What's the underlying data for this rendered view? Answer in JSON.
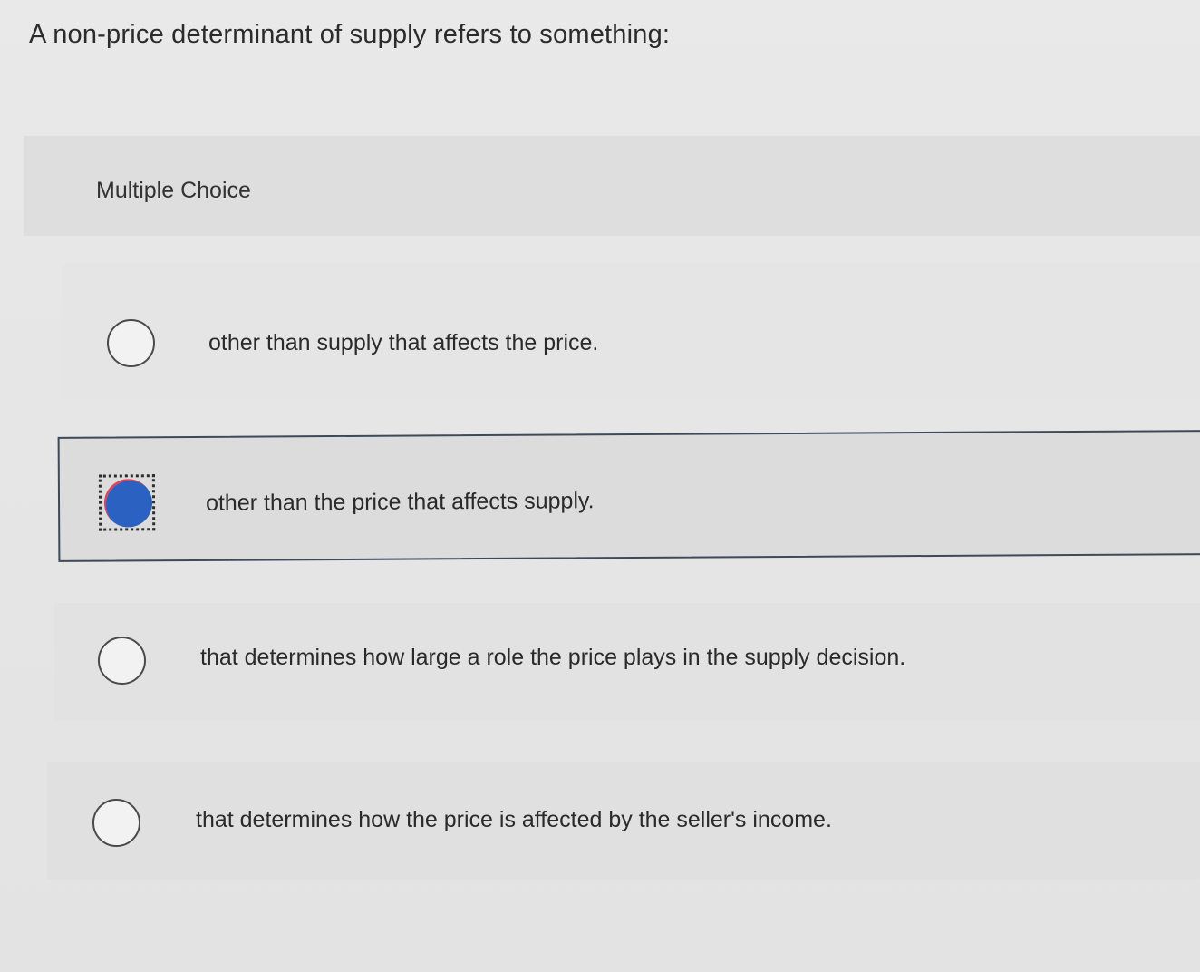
{
  "question": {
    "text": "A non-price determinant of supply refers to something:"
  },
  "question_type": {
    "label": "Multiple Choice"
  },
  "options": [
    {
      "text": "other than supply that affects the price.",
      "selected": false
    },
    {
      "text": "other than the price that affects supply.",
      "selected": true
    },
    {
      "text": "that determines how large a role the price plays in the supply decision.",
      "selected": false
    },
    {
      "text": "that determines how the price is affected by the seller's income.",
      "selected": false
    }
  ],
  "colors": {
    "selected_radio": "#2b62c2",
    "selected_border": "#3e4a5a",
    "background": "#e6e6e6"
  }
}
